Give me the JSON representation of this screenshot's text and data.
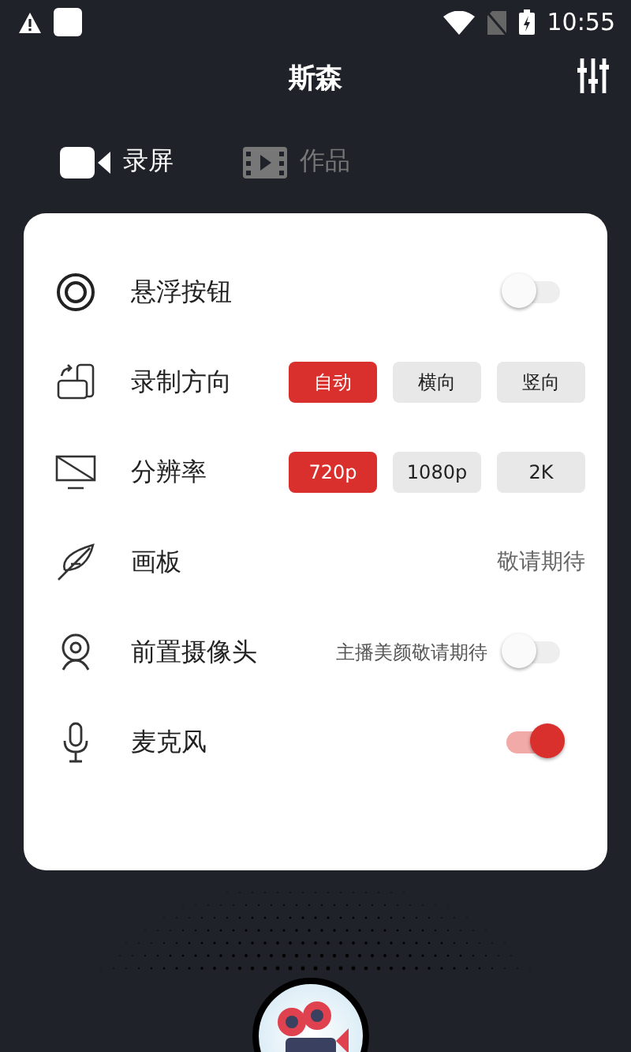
{
  "status_bar": {
    "time": "10:55"
  },
  "header": {
    "title": "斯森"
  },
  "tabs": [
    {
      "label": "录屏",
      "selected": true,
      "kind": "camera"
    },
    {
      "label": "作品",
      "selected": false,
      "kind": "film"
    }
  ],
  "settings": [
    {
      "kind": "toggle",
      "label": "悬浮按钮",
      "on": false
    },
    {
      "kind": "options",
      "label": "录制方向",
      "options": [
        {
          "label": "自动",
          "selected": true
        },
        {
          "label": "横向",
          "selected": false
        },
        {
          "label": "竖向",
          "selected": false
        }
      ]
    },
    {
      "kind": "options",
      "label": "分辨率",
      "options": [
        {
          "label": "720p",
          "selected": true
        },
        {
          "label": "1080p",
          "selected": false
        },
        {
          "label": "2K",
          "selected": false
        }
      ]
    },
    {
      "kind": "note",
      "label": "画板",
      "note": "敬请期待"
    },
    {
      "kind": "toggle",
      "label": "前置摄像头",
      "note": "主播美颜敬请期待",
      "on": false
    },
    {
      "kind": "toggle",
      "label": "麦克风",
      "on": true
    }
  ]
}
